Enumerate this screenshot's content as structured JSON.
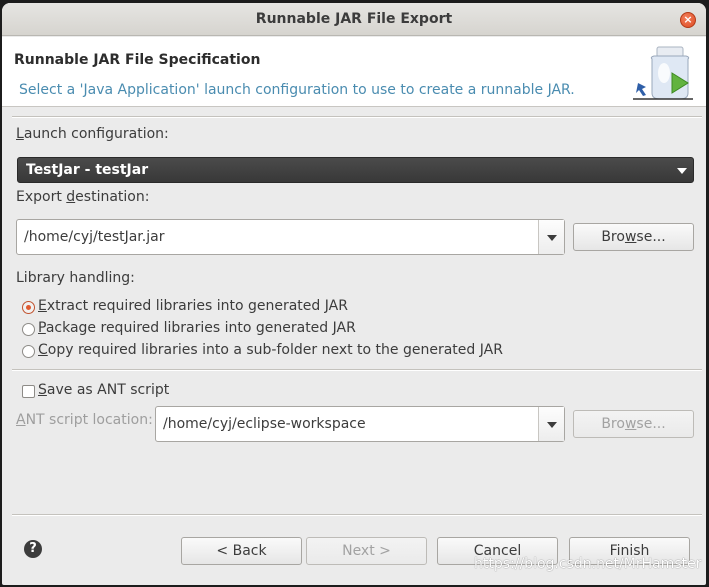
{
  "window": {
    "title": "Runnable JAR File Export",
    "close_glyph": "×"
  },
  "header": {
    "title": "Runnable JAR File Specification",
    "description": "Select a 'Java Application' launch configuration to use to create a runnable JAR.",
    "icon": "jar-export-wizard-icon"
  },
  "launch": {
    "label_pre": "",
    "label_key": "L",
    "label_post": "aunch configuration:",
    "value": "TestJar - testJar"
  },
  "export": {
    "label_pre": "Export ",
    "label_key": "d",
    "label_post": "estination:",
    "value": "/home/cyj/testJar.jar",
    "browse_pre": "Bro",
    "browse_key": "w",
    "browse_post": "se..."
  },
  "library": {
    "label": "Library handling:",
    "options": [
      {
        "key": "E",
        "rest": "xtract required libraries into generated JAR",
        "checked": true
      },
      {
        "key": "P",
        "rest": "ackage required libraries into generated JAR",
        "checked": false
      },
      {
        "key": "C",
        "rest": "opy required libraries into a sub-folder next to the generated JAR",
        "checked": false
      }
    ]
  },
  "ant": {
    "checkbox_key": "S",
    "checkbox_rest": "ave as ANT script",
    "location_key": "A",
    "location_rest": "NT script location:",
    "location_value": "/home/cyj/eclipse-workspace",
    "browse_pre": "Bro",
    "browse_key": "w",
    "browse_post": "se..."
  },
  "footer": {
    "help_glyph": "?",
    "back_label": "< Back",
    "next_label": "Next >",
    "cancel_label": "Cancel",
    "finish_label": "Finish"
  },
  "watermark": "https://blog.csdn.net/MrHamster"
}
